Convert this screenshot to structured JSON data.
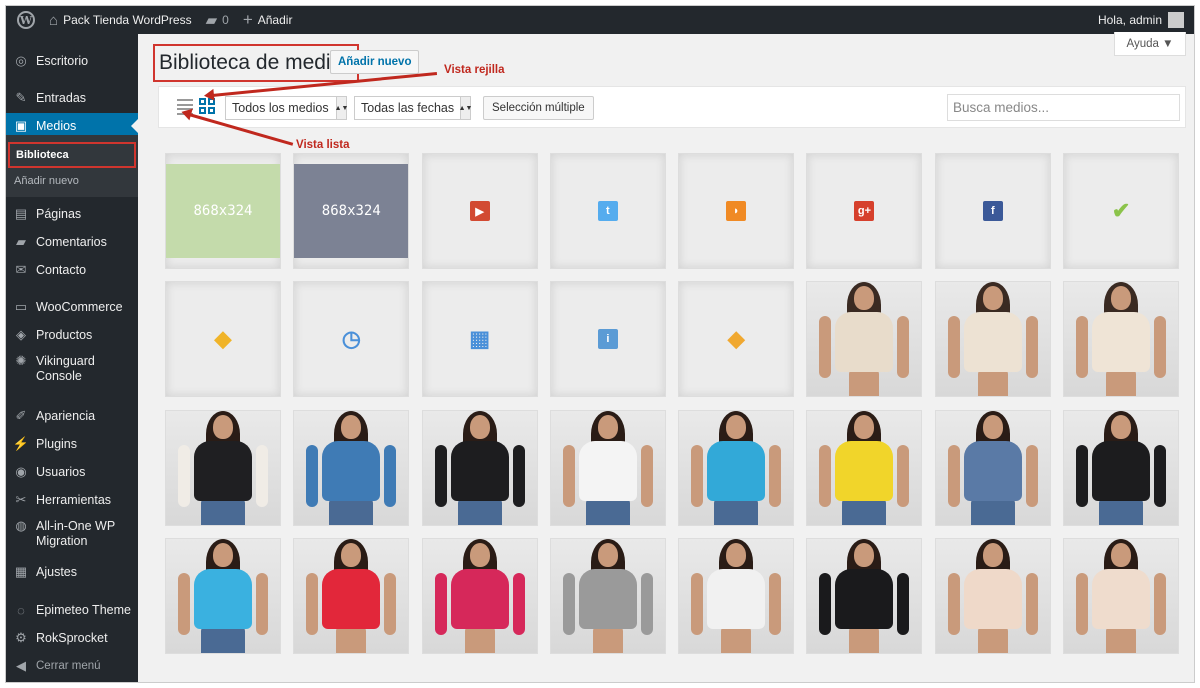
{
  "adminbar": {
    "wp_logo": "W",
    "site_name": "Pack Tienda WordPress",
    "comments_count": "0",
    "new_label": "Añadir",
    "greeting": "Hola, admin",
    "icons": {
      "site": "home-icon",
      "comments": "comment-bubble-icon",
      "new": "plus-icon"
    }
  },
  "sidebar": {
    "items": [
      {
        "label": "Escritorio",
        "icon": "◎"
      },
      {
        "label": "Entradas",
        "icon": "✎"
      },
      {
        "label": "Medios",
        "icon": "▣"
      },
      {
        "label": "Páginas",
        "icon": "▤"
      },
      {
        "label": "Comentarios",
        "icon": "▰"
      },
      {
        "label": "Contacto",
        "icon": "✉"
      },
      {
        "label": "WooCommerce",
        "icon": "▭"
      },
      {
        "label": "Productos",
        "icon": "◈"
      },
      {
        "label": "Vikinguard Console",
        "icon": "✺"
      },
      {
        "label": "Apariencia",
        "icon": "✐"
      },
      {
        "label": "Plugins",
        "icon": "⚡"
      },
      {
        "label": "Usuarios",
        "icon": "◉"
      },
      {
        "label": "Herramientas",
        "icon": "✂"
      },
      {
        "label": "All-in-One WP Migration",
        "icon": "◍"
      },
      {
        "label": "Ajustes",
        "icon": "▦"
      },
      {
        "label": "Epimeteo Theme",
        "icon": "◌"
      },
      {
        "label": "RokSprocket",
        "icon": "⚙"
      },
      {
        "label": "Cerrar menú",
        "icon": "◀"
      }
    ],
    "submenu": [
      {
        "label": "Biblioteca"
      },
      {
        "label": "Añadir nuevo"
      }
    ]
  },
  "main": {
    "title": "Biblioteca de medios",
    "add_new": "Añadir nuevo",
    "help": "Ayuda ▼",
    "filter_type": "Todos los medios",
    "filter_date": "Todas las fechas",
    "bulk_select": "Selección múltiple",
    "search_placeholder": "Busca medios...",
    "annotation_grid": "Vista rejilla",
    "annotation_list": "Vista lista"
  },
  "colors": {
    "accent": "#0073aa",
    "annotation": "#c0281e",
    "placeholder_green": "#c4dbab",
    "placeholder_slate": "#7c8294"
  },
  "media": [
    {
      "kind": "placeholder",
      "text": "868x324",
      "color": "#c4dbab"
    },
    {
      "kind": "placeholder",
      "text": "868x324",
      "color": "#7c8294"
    },
    {
      "kind": "icon",
      "name": "youtube-icon",
      "glyph": "▶",
      "color": "#d24a32"
    },
    {
      "kind": "icon",
      "name": "twitter-icon",
      "glyph": "t",
      "color": "#55acee"
    },
    {
      "kind": "icon",
      "name": "rss-icon",
      "glyph": "◗",
      "color": "#f08a24"
    },
    {
      "kind": "icon",
      "name": "google-plus-icon",
      "glyph": "g+",
      "color": "#d6402c"
    },
    {
      "kind": "icon",
      "name": "facebook-icon",
      "glyph": "f",
      "color": "#3b5998"
    },
    {
      "kind": "icon",
      "name": "checkmark-icon",
      "glyph": "✔",
      "color": "transparent",
      "fg": "#8bc34a"
    },
    {
      "kind": "icon",
      "name": "tag-icon",
      "glyph": "◆",
      "color": "transparent",
      "fg": "#f0b429"
    },
    {
      "kind": "icon",
      "name": "clock-icon",
      "glyph": "◷",
      "color": "transparent",
      "fg": "#4a90d9"
    },
    {
      "kind": "icon",
      "name": "gift-icon",
      "glyph": "▦",
      "color": "transparent",
      "fg": "#4a90d9"
    },
    {
      "kind": "icon",
      "name": "info-icon",
      "glyph": "i",
      "color": "#5b9bd5"
    },
    {
      "kind": "icon",
      "name": "small-tag-icon",
      "glyph": "◆",
      "color": "transparent",
      "fg": "#f0a830"
    },
    {
      "kind": "photo",
      "name": "halter-dress-photo",
      "top": "#e8dccb",
      "legs": "skin",
      "hair": "#3a2a22"
    },
    {
      "kind": "photo",
      "name": "cream-dress-photo",
      "top": "#ede2d3",
      "legs": "skin",
      "hair": "#3a2a22"
    },
    {
      "kind": "photo",
      "name": "strapless-dress-photo",
      "top": "#efe4d6",
      "legs": "skin",
      "hair": "#3a2a22"
    },
    {
      "kind": "photo",
      "name": "varsity-jacket-photo",
      "top": "#1f1f22",
      "arm": "#f0ece6",
      "legs": "jeans",
      "hair": "#2a1c16"
    },
    {
      "kind": "photo",
      "name": "denim-jacket-photo",
      "top": "#3f7bb5",
      "arm": "#3f7bb5",
      "legs": "jeans",
      "hair": "#2a1c16"
    },
    {
      "kind": "photo",
      "name": "leather-jacket-photo",
      "top": "#1d1d1f",
      "arm": "#1d1d1f",
      "legs": "jeans",
      "hair": "#2a1c16"
    },
    {
      "kind": "photo",
      "name": "white-tank-photo",
      "top": "#f4f4f4",
      "arm": "#c99a7b",
      "legs": "jeans",
      "hair": "#2a1c16"
    },
    {
      "kind": "photo",
      "name": "blue-polo-photo",
      "top": "#32a9d8",
      "arm": "#c99a7b",
      "legs": "jeans",
      "hair": "#2a1c16"
    },
    {
      "kind": "photo",
      "name": "yellow-polo-photo",
      "top": "#f1d52a",
      "arm": "#c99a7b",
      "legs": "jeans",
      "hair": "#2a1c16"
    },
    {
      "kind": "photo",
      "name": "jeans-photo",
      "top": "#5a7aa6",
      "arm": "#c99a7b",
      "legs": "jeans",
      "hair": "#2a1c16"
    },
    {
      "kind": "photo",
      "name": "black-jacket-photo",
      "top": "#1c1c1e",
      "arm": "#1c1c1e",
      "legs": "jeans",
      "hair": "#2a1c16"
    },
    {
      "kind": "photo",
      "name": "blue-polo-2-photo",
      "top": "#3ab1e0",
      "arm": "#c99a7b",
      "legs": "jeans",
      "hair": "#2a1c16"
    },
    {
      "kind": "photo",
      "name": "red-dress-photo",
      "top": "#e2273a",
      "arm": "#c99a7b",
      "legs": "skin",
      "hair": "#2a1c16"
    },
    {
      "kind": "photo",
      "name": "pink-dress-photo",
      "top": "#d6285a",
      "arm": "#d6285a",
      "legs": "skin",
      "hair": "#2a1c16"
    },
    {
      "kind": "photo",
      "name": "striped-hoodie-photo",
      "top": "#9a9a9a",
      "arm": "#9a9a9a",
      "legs": "skin",
      "hair": "#2a1c16"
    },
    {
      "kind": "photo",
      "name": "white-polo-dress-photo",
      "top": "#f1f1f1",
      "arm": "#c99a7b",
      "legs": "skin",
      "hair": "#2a1c16"
    },
    {
      "kind": "photo",
      "name": "black-hoodie-dress-photo",
      "top": "#1a1a1c",
      "arm": "#1a1a1c",
      "legs": "skin",
      "hair": "#2a1c16"
    },
    {
      "kind": "photo",
      "name": "strapless-pink-dress-photo",
      "top": "#efd9c9",
      "arm": "#c99a7b",
      "legs": "skin",
      "hair": "#2a1c16"
    },
    {
      "kind": "photo",
      "name": "strapless-pink-dress-2-photo",
      "top": "#efdccd",
      "arm": "#c99a7b",
      "legs": "skin",
      "hair": "#2a1c16"
    }
  ]
}
